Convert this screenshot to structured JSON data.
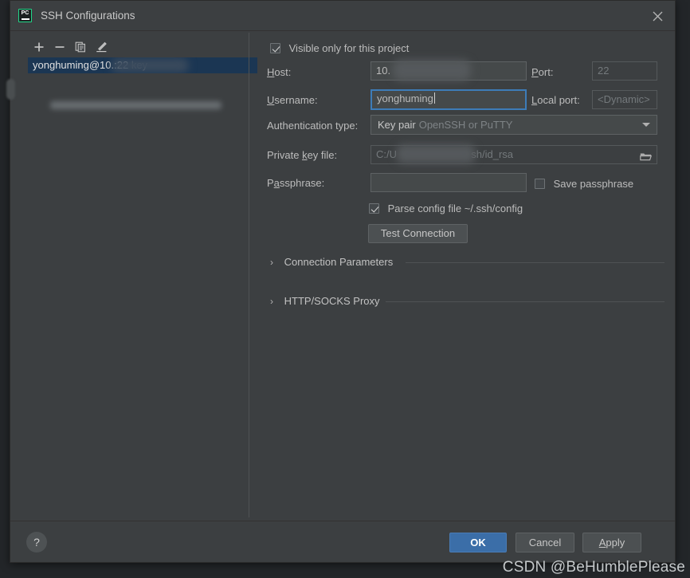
{
  "window": {
    "title": "SSH Configurations",
    "app_icon": "pycharm-icon",
    "app_icon_text": "PC",
    "close_icon": "close-icon",
    "accent_color": "#3b6ea8",
    "icon_border_color": "#21d789"
  },
  "list_panel": {
    "toolbar": [
      {
        "name": "add",
        "icon": "plus-icon"
      },
      {
        "name": "remove",
        "icon": "minus-icon"
      },
      {
        "name": "copy",
        "icon": "copy-icon"
      },
      {
        "name": "edit",
        "icon": "pencil-icon"
      }
    ],
    "items": [
      {
        "prefix": "yonghuming@10.",
        "redacted": true,
        "suffix_port": ":22",
        "suffix_auth": "key",
        "selected": true,
        "selected_bg": "#1b3653"
      }
    ]
  },
  "form": {
    "visible_only": {
      "label": "Visible only for this project",
      "checked": true
    },
    "host": {
      "label": "Host:",
      "label_mnemonic": "H",
      "value": "10.",
      "redacted": true
    },
    "port": {
      "label": "Port:",
      "label_mnemonic": "P",
      "value": "22",
      "is_placeholder": true
    },
    "username": {
      "label": "Username:",
      "label_mnemonic": "U",
      "value": "yonghuming",
      "focused": true
    },
    "local_port": {
      "label": "Local port:",
      "label_mnemonic": "L",
      "value": "<Dynamic>",
      "is_placeholder": true
    },
    "auth_type": {
      "label": "Authentication type:",
      "label_mnemonic": "t",
      "value": "Key pair",
      "value_hint": "OpenSSH or PuTTY",
      "icon": "chevron-down-icon"
    },
    "private_key": {
      "label": "Private key file:",
      "label_mnemonic": "k",
      "value_start": "C:/U",
      "value_end": "sh/id_rsa",
      "redacted": true,
      "browse_icon": "folder-icon"
    },
    "passphrase": {
      "label": "Passphrase:",
      "label_mnemonic": "a",
      "value": ""
    },
    "save_passphrase": {
      "label": "Save passphrase",
      "label_mnemonic": "e",
      "checked": false
    },
    "parse_config": {
      "label": "Parse config file ~/.ssh/config",
      "checked": true
    },
    "test_connection": {
      "label": "Test Connection",
      "label_mnemonic": "C"
    },
    "sections": [
      {
        "title": "Connection Parameters",
        "expanded": false,
        "icon": "chevron-right-icon"
      },
      {
        "title": "HTTP/SOCKS Proxy",
        "expanded": false,
        "icon": "chevron-right-icon"
      }
    ]
  },
  "footer": {
    "help": "?",
    "help_icon": "help-icon",
    "ok": "OK",
    "cancel": "Cancel",
    "apply": "Apply",
    "apply_mnemonic": "A"
  },
  "watermark": "CSDN @BeHumblePlease"
}
